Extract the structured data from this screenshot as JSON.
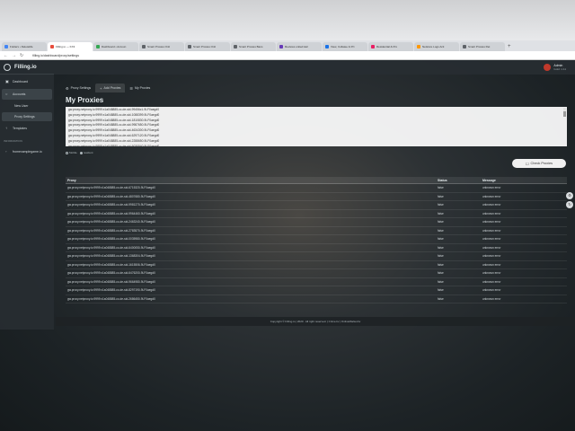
{
  "browser": {
    "tabs": [
      {
        "label": "Folders • DeleteMe",
        "active": false,
        "color": "#4285f4"
      },
      {
        "label": "Filling.io — KX3",
        "active": true,
        "color": "#e74c3c"
      },
      {
        "label": "Dashboard • Accoun",
        "active": false,
        "color": "#34a853"
      },
      {
        "label": "Smart Proxies Onli",
        "active": false,
        "color": "#5f6368"
      },
      {
        "label": "Smart Proxies Onli",
        "active": false,
        "color": "#5f6368"
      },
      {
        "label": "Smart Proxies Bans",
        "active": false,
        "color": "#5f6368"
      },
      {
        "label": "Reviews united kari",
        "active": false,
        "color": "#673ab7"
      },
      {
        "label": "View, Collatee & Prt",
        "active": false,
        "color": "#1a73e8"
      },
      {
        "label": "Residential & Pro",
        "active": false,
        "color": "#e91e63"
      },
      {
        "label": "Netstore Logs Acti",
        "active": false,
        "color": "#ff9800"
      },
      {
        "label": "Smart Proxies Ret",
        "active": false,
        "color": "#5f6368"
      }
    ],
    "url": "filling.io/dashboard/proxy/settings"
  },
  "sidebar": {
    "brand": "Filling.io",
    "items": [
      {
        "label": "Dashboard",
        "icon": "dashboard-icon"
      },
      {
        "label": "Accounts",
        "icon": "accounts-icon",
        "active": true
      },
      {
        "label": "New User",
        "icon": "",
        "sub": true
      },
      {
        "label": "Proxy Settings",
        "icon": "",
        "sub": true,
        "active": true
      },
      {
        "label": "Templates",
        "icon": "templates-icon"
      }
    ],
    "section_label": "INFORMATION",
    "extra_item": "fromexamplegame.io"
  },
  "topbar": {
    "user_name": "Admin",
    "user_sub": "Gold: 1.11"
  },
  "subtabs": [
    {
      "label": "Proxy Settings",
      "icon": "gear-icon",
      "active": false
    },
    {
      "label": "Add Proxies",
      "icon": "plus-icon",
      "active": true
    },
    {
      "label": "My Proxies",
      "icon": "list-icon",
      "active": false
    }
  ],
  "page_title": "My Proxies",
  "textarea_lines": [
    "gw.proxy.netproxy.io:9999:x1a048885-cc-de-sid-99456c1-9LF0aegd0",
    "gw.proxy.netproxy.io:9999:x1a048885-cc-de-sid-1088399-9LF0aegd0",
    "gw.proxy.netproxy.io:9999:x1a048885-cc-de-sid-1810830-9LF0aegd0",
    "gw.proxy.netproxy.io:9999:x1a048885-cc-de-sid-9987650-9LF0aegd0",
    "gw.proxy.netproxy.io:9999:x1a048885-cc-de-sid-4634300-9LF0aegd0",
    "gw.proxy.netproxy.io:9999:x1a048885-cc-de-sid-6297120-9LF0aegd0",
    "gw.proxy.netproxy.io:9999:x1a048885-cc-de-sid-2288650-9LF0aegd0",
    "gw.proxy.netproxy.io:9999:x1a048885-cc-de-sid-6030540-9LF0aegd0"
  ],
  "radios": {
    "option1": "Mobile",
    "option2": "resident"
  },
  "check_button": "Check Proxies",
  "table": {
    "headers": [
      "Proxy",
      "Status",
      "Message"
    ],
    "rows": [
      [
        "gw.proxy.netproxy.io:9999:x1a048885-cc-de-sid-6715320-9LF0aegd0",
        "false",
        "unknown error"
      ],
      [
        "gw.proxy.netproxy.io:9999:x1a048885-cc-de-sid-4807680-9LF0aegd0",
        "false",
        "unknown error"
      ],
      [
        "gw.proxy.netproxy.io:9999:x1a048885-cc-de-sid-9981270-9LF0aegd0",
        "false",
        "unknown error"
      ],
      [
        "gw.proxy.netproxy.io:9999:x1a048885-cc-de-sid-9964460-9LF0aegd0",
        "false",
        "unknown error"
      ],
      [
        "gw.proxy.netproxy.io:9999:x1a048885-cc-de-sid-2463240-9LF0aegd0",
        "false",
        "unknown error"
      ],
      [
        "gw.proxy.netproxy.io:9999:x1a048885-cc-de-sid-2783570-9LF0aegd0",
        "false",
        "unknown error"
      ],
      [
        "gw.proxy.netproxy.io:9999:x1a048885-cc-de-sid-0035980-9LF0aegd0",
        "false",
        "unknown error"
      ],
      [
        "gw.proxy.netproxy.io:9999:x1a048885-cc-de-sid-6400050-9LF0aegd0",
        "false",
        "unknown error"
      ],
      [
        "gw.proxy.netproxy.io:9999:x1a048885-cc-de-sid-1368304-9LF0aegd0",
        "false",
        "unknown error"
      ],
      [
        "gw.proxy.netproxy.io:9999:x1a048885-cc-de-sid-1615506-9LF0aegd0",
        "false",
        "unknown error"
      ],
      [
        "gw.proxy.netproxy.io:9999:x1a048885-cc-de-sid-6476200-9LF0aegd0",
        "false",
        "unknown error"
      ],
      [
        "gw.proxy.netproxy.io:9999:x1a048885-cc-de-sid-9664980-9LF0aegd0",
        "false",
        "unknown error"
      ],
      [
        "gw.proxy.netproxy.io:9999:x1a048885-cc-de-sid-8297190-9LF0aegd0",
        "false",
        "unknown error"
      ],
      [
        "gw.proxy.netproxy.io:9999:x1a048885-cc-de-sid-2686450-9LF0aegd0",
        "false",
        "unknown error"
      ]
    ]
  },
  "footer": "Copyright © Filling.io | 2020 . All right reserved. | Crime.liv | OnlineMarket.liv"
}
